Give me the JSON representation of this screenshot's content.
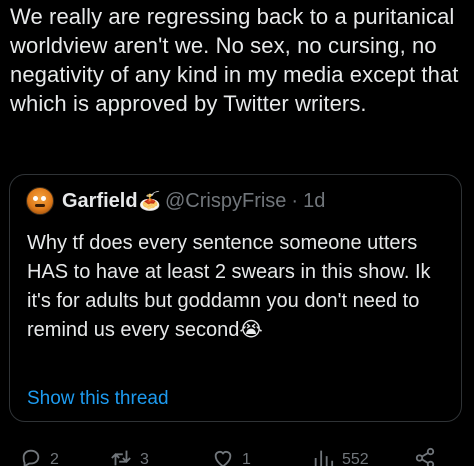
{
  "tweet": {
    "text": "We really are regressing back to a puritanical worldview aren't we. No sex, no cursing, no negativity of any kind in my media except that which is approved by Twitter writers."
  },
  "quote": {
    "display_name": "Garfield",
    "name_emoji": "🍝",
    "handle": "@CrispyFrise",
    "separator": "·",
    "time": "1d",
    "text": "Why tf does every sentence someone utters HAS to have at least 2 swears in this show. Ik it's for adults but goddamn you don't need to remind us every second😭",
    "show_thread": "Show this thread"
  },
  "actions": {
    "reply_count": "2",
    "retweet_count": "3",
    "like_count": "1",
    "views_count": "552"
  },
  "colors": {
    "background": "#000000",
    "text": "#e7e9ea",
    "secondary": "#71767b",
    "link": "#1d9bf0",
    "border": "#2f3336"
  },
  "icons": [
    "reply-icon",
    "retweet-icon",
    "like-icon",
    "views-icon",
    "share-icon"
  ]
}
